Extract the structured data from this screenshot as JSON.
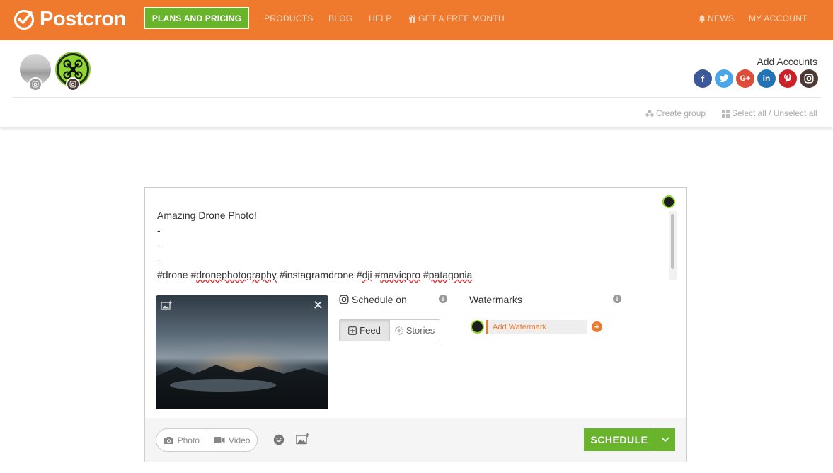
{
  "brand": {
    "name": "Postcron",
    "accent": "#ef7a2d",
    "green": "#68b42b"
  },
  "nav": {
    "plans_label": "PLANS AND PRICING",
    "products": "PRODUCTS",
    "blog": "BLOG",
    "help": "HELP",
    "free_month": "GET A FREE MONTH",
    "news": "NEWS",
    "my_account": "MY ACCOUNT"
  },
  "accounts": {
    "add_label": "Add Accounts",
    "networks": [
      {
        "name": "facebook",
        "glyph": "f",
        "color": "#3b5998"
      },
      {
        "name": "twitter",
        "glyph": "t",
        "color": "#4aa6e8"
      },
      {
        "name": "google-plus",
        "glyph": "G+",
        "color": "#dd4b39"
      },
      {
        "name": "linkedin",
        "glyph": "in",
        "color": "#2273b5"
      },
      {
        "name": "pinterest",
        "glyph": "P",
        "color": "#cb2027"
      },
      {
        "name": "instagram",
        "glyph": "ig",
        "color": "#4a3a33"
      }
    ],
    "create_group": "Create group",
    "select_all": "Select all / Unselect all"
  },
  "composer": {
    "lines": [
      "Amazing Drone Photo!",
      "-",
      "-",
      "-"
    ],
    "tags": {
      "drone": "#drone",
      "dronephotography_hash": "#",
      "dronephotography": "dronephotography",
      "instagramdrone": "#instagramdrone",
      "dji_hash": "#",
      "dji": "dji",
      "mavicpro_hash": "#",
      "mavicpro": "mavicpro",
      "patagonia_hash": "#",
      "patagonia": "patagonia"
    },
    "schedule_on": "Schedule on",
    "feed": "Feed",
    "stories": "Stories",
    "watermarks": "Watermarks",
    "add_watermark": "Add Watermark",
    "photo": "Photo",
    "video": "Video",
    "schedule": "SCHEDULE"
  }
}
